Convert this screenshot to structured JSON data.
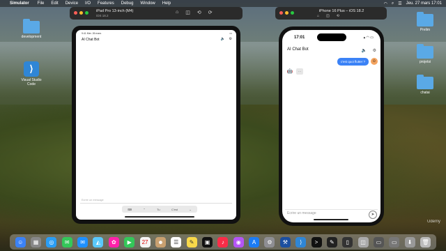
{
  "menubar": {
    "app_name": "Simulator",
    "items": [
      "File",
      "Edit",
      "Device",
      "I/O",
      "Features",
      "Debug",
      "Window",
      "Help"
    ],
    "clock": "Jeu. 27 mars 17:01"
  },
  "desktop": {
    "icons": [
      {
        "label": "development"
      },
      {
        "label": "Visual Studio Code"
      },
      {
        "label": "Prelim"
      },
      {
        "label": "projetsi"
      },
      {
        "label": "chatai"
      }
    ]
  },
  "ipad_window": {
    "title": "iPad Pro 13-inch (M4)",
    "subtitle": "iOS 18.2",
    "status_left": "9:41  Mer. 26 mars",
    "app_title": "AI Chat Bot",
    "input_placeholder": "Ecrire un message",
    "keyboard_items": [
      "⌨",
      "⌃",
      "Tu",
      "C'est",
      "⌄"
    ]
  },
  "iphone_window": {
    "title": "iPhone 16 Plus – iOS 18.2",
    "time": "17:01",
    "app_title": "AI Chat Bot",
    "user_message": "c'est quoi flutter ?",
    "typing_indicator": "…",
    "input_placeholder": "Ecrire un message"
  },
  "watermark": "Udemy",
  "colors": {
    "bubble": "#3b82f6",
    "folder": "#5aa9e6",
    "vscode": "#2f86d6"
  }
}
